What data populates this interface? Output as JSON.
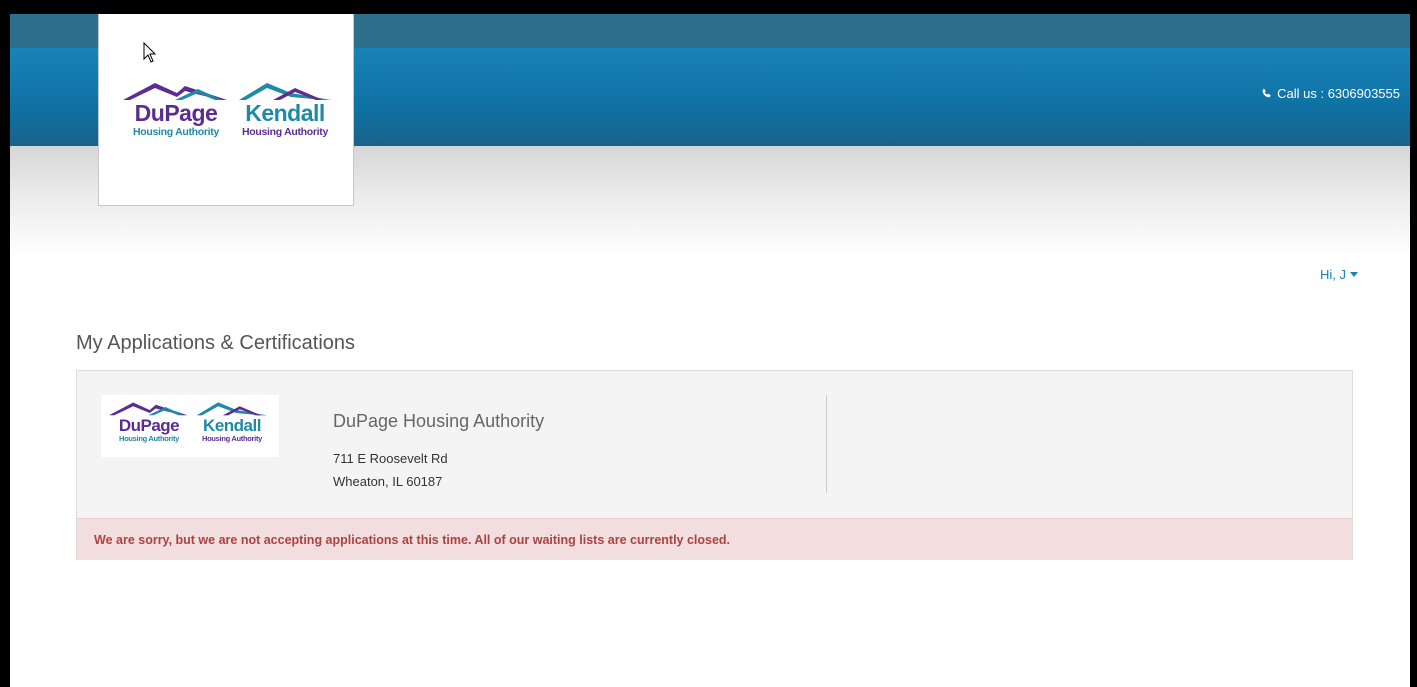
{
  "header": {
    "call_label": "Call us : 6306903555",
    "phone_icon": "phone-icon",
    "logo": {
      "org1_name": "DuPage",
      "org1_sub": "Housing Authority",
      "org2_name": "Kendall",
      "org2_sub": "Housing Authority"
    }
  },
  "user": {
    "greeting": "Hi, J",
    "menu_icon": "caret-down-icon"
  },
  "main": {
    "title": "My Applications & Certifications",
    "card": {
      "logo": {
        "org1_name": "DuPage",
        "org1_sub": "Housing Authority",
        "org2_name": "Kendall",
        "org2_sub": "Housing Authority"
      },
      "org_name": "DuPage Housing Authority",
      "address_line1": "711 E Roosevelt Rd",
      "address_line2": "Wheaton, IL 60187",
      "alert": "We are sorry, but we are not accepting applications at this time. All of our waiting lists are currently closed."
    }
  },
  "colors": {
    "header_blue": "#0f73a6",
    "topbar": "#2c6e8c",
    "link": "#1a82b7",
    "brand_purple": "#5b2d90",
    "brand_teal": "#1f8aa5",
    "alert_bg": "#f2dede",
    "alert_text": "#a94442"
  }
}
